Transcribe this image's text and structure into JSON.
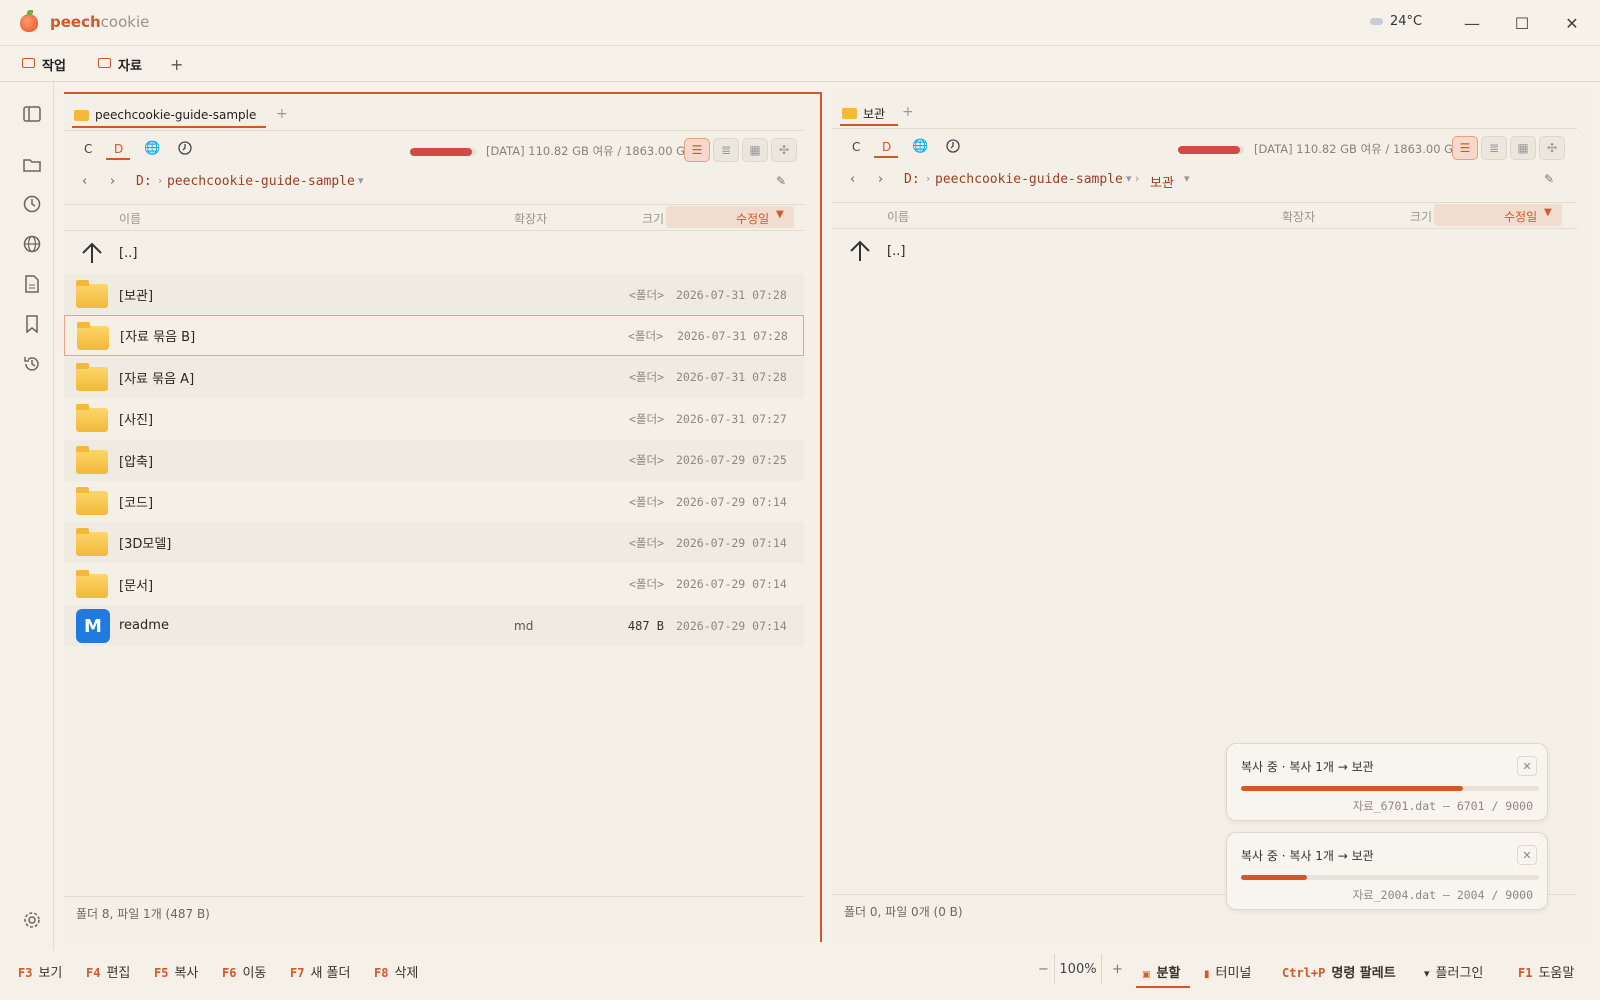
{
  "app": {
    "name_accent": "peech",
    "name_rest": "cookie",
    "weather": "24°C"
  },
  "window_controls": {
    "minimize": "—",
    "maximize": "☐",
    "close": "✕"
  },
  "workspace_tabs": [
    {
      "label": "작업"
    },
    {
      "label": "자료"
    }
  ],
  "workspace_add": "+",
  "left": {
    "tab": "peechcookie-guide-sample",
    "tab_add": "+",
    "drives": {
      "c": "C",
      "d": "D"
    },
    "disk_text": "[DATA] 110.82 GB 여유 / 1863.00 GB",
    "disk_used_fraction": 0.94,
    "crumbs": [
      "D:",
      "peechcookie-guide-sample"
    ],
    "headers": {
      "name": "이름",
      "ext": "확장자",
      "size": "크기",
      "date": "수정일"
    },
    "up": "[..]",
    "rows": [
      {
        "name": "[보관]",
        "ext": "",
        "size": "<폴더>",
        "date": "2026-07-31 07:28"
      },
      {
        "name": "[자료 묶음 B]",
        "ext": "",
        "size": "<폴더>",
        "date": "2026-07-31 07:28"
      },
      {
        "name": "[자료 묶음 A]",
        "ext": "",
        "size": "<폴더>",
        "date": "2026-07-31 07:28"
      },
      {
        "name": "[사진]",
        "ext": "",
        "size": "<폴더>",
        "date": "2026-07-31 07:27"
      },
      {
        "name": "[압축]",
        "ext": "",
        "size": "<폴더>",
        "date": "2026-07-29 07:25"
      },
      {
        "name": "[코드]",
        "ext": "",
        "size": "<폴더>",
        "date": "2026-07-29 07:14"
      },
      {
        "name": "[3D모델]",
        "ext": "",
        "size": "<폴더>",
        "date": "2026-07-29 07:14"
      },
      {
        "name": "[문서]",
        "ext": "",
        "size": "<폴더>",
        "date": "2026-07-29 07:14"
      },
      {
        "name": "readme",
        "ext": "md",
        "size": "487 B",
        "date": "2026-07-29 07:14"
      }
    ],
    "status": "폴더 8, 파일 1개 (487 B)"
  },
  "right": {
    "tab": "보관",
    "tab_add": "+",
    "drives": {
      "c": "C",
      "d": "D"
    },
    "disk_text": "[DATA] 110.82 GB 여유 / 1863.00 GB",
    "disk_used_fraction": 0.94,
    "crumbs": [
      "D:",
      "peechcookie-guide-sample",
      "보관"
    ],
    "headers": {
      "name": "이름",
      "ext": "확장자",
      "size": "크기",
      "date": "수정일"
    },
    "up": "[..]",
    "status": "폴더 0, 파일 0개 (0 B)"
  },
  "toasts": [
    {
      "title": "복사 중 · 복사 1개 → 보관",
      "detail": "자료_6701.dat — 6701 / 9000",
      "progress": 0.745
    },
    {
      "title": "복사 중 · 복사 1개 → 보관",
      "detail": "자료_2004.dat — 2004 / 9000",
      "progress": 0.223
    }
  ],
  "fkeys": [
    {
      "key": "F3",
      "label": "보기"
    },
    {
      "key": "F4",
      "label": "편집"
    },
    {
      "key": "F5",
      "label": "복사"
    },
    {
      "key": "F6",
      "label": "이동"
    },
    {
      "key": "F7",
      "label": "새 폴더"
    },
    {
      "key": "F8",
      "label": "삭제"
    }
  ],
  "bottom_right": {
    "zoom_minus": "−",
    "zoom": "100%",
    "zoom_plus": "+",
    "split": "분할",
    "terminal": "터미널",
    "palette_key": "Ctrl+P",
    "palette": "명령 팔레트",
    "plugin": "플러그인",
    "help_key": "F1",
    "help": "도움말"
  },
  "colors": {
    "accent": "#d4572a",
    "disk_bar": "#d24a45",
    "background": "#f5f1e9"
  }
}
